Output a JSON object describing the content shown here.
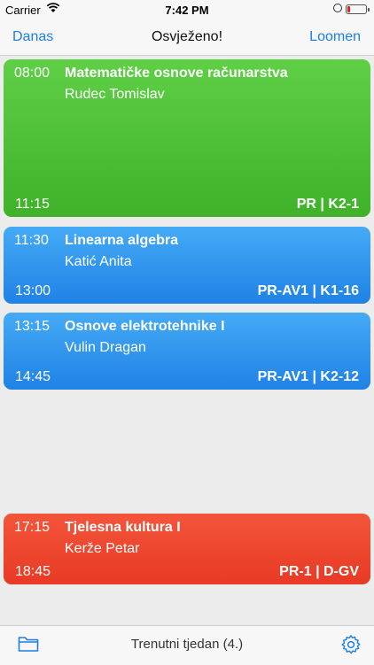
{
  "status_bar": {
    "carrier": "Carrier",
    "time": "7:42 PM"
  },
  "nav": {
    "left_button": "Danas",
    "title": "Osvježeno!",
    "right_button": "Loomen"
  },
  "events": [
    {
      "start": "08:00",
      "end": "11:15",
      "subject": "Matematičke osnove računarstva",
      "lecturer": "Rudec Tomislav",
      "location": "PR | K2-1",
      "color": "#4cc135"
    },
    {
      "start": "11:30",
      "end": "13:00",
      "subject": "Linearna algebra",
      "lecturer": "Katić Anita",
      "location": "PR-AV1 | K1-16",
      "color": "#2f93ee"
    },
    {
      "start": "13:15",
      "end": "14:45",
      "subject": "Osnove elektrotehnike I",
      "lecturer": "Vulin Dragan",
      "location": "PR-AV1 | K2-12",
      "color": "#2f93ee"
    },
    {
      "start": "17:15",
      "end": "18:45",
      "subject": "Tjelesna kultura I",
      "lecturer": "Kerže Petar",
      "location": "PR-1 | D-GV",
      "color": "#ee472f"
    }
  ],
  "tab_bar": {
    "week_label": "Trenutni tjedan (4.)",
    "left_icon": "folder-icon",
    "right_icon": "gear-icon"
  },
  "colors": {
    "accent": "#1d7fe6",
    "background": "#ececec"
  }
}
